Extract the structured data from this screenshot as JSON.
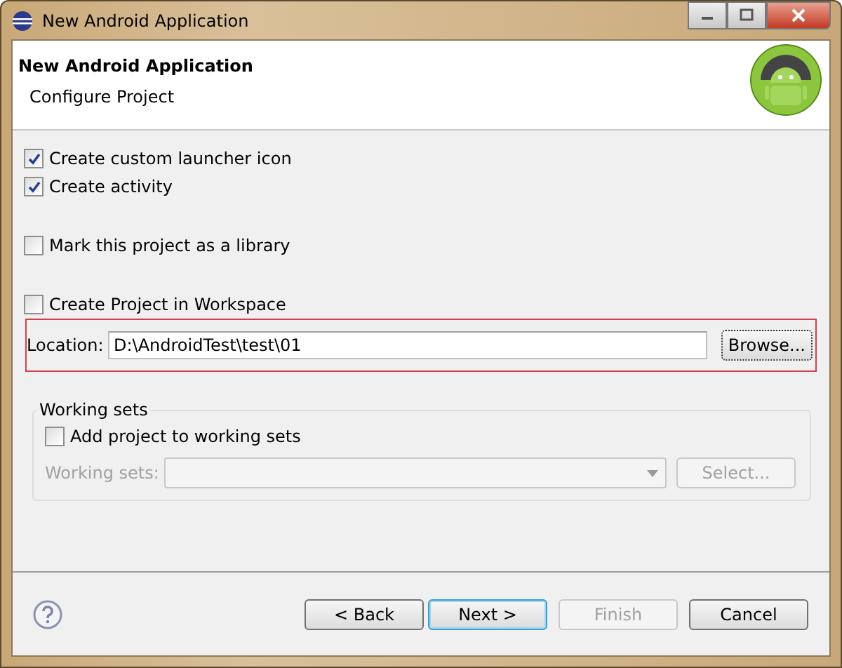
{
  "window": {
    "title": "New Android Application"
  },
  "header": {
    "title": "New Android Application",
    "subtitle": "Configure Project"
  },
  "options": [
    {
      "label": "Create custom launcher icon",
      "checked": true
    },
    {
      "label": "Create activity",
      "checked": true
    },
    {
      "label": "Mark this project as a library",
      "checked": false
    },
    {
      "label": "Create Project in Workspace",
      "checked": false
    }
  ],
  "location": {
    "label": "Location:",
    "value": "D:\\AndroidTest\\test\\01",
    "button": "Browse...",
    "highlighted": true
  },
  "working_sets": {
    "title": "Working sets",
    "add": {
      "label": "Add project to working sets",
      "checked": false
    },
    "label": "Working sets:",
    "disabled": true,
    "button": "Select..."
  },
  "buttons": [
    {
      "label": "< Back",
      "disabled": false,
      "default": false
    },
    {
      "label": "Next >",
      "disabled": false,
      "default": true
    },
    {
      "label": "Finish",
      "disabled": true,
      "default": false
    },
    {
      "label": "Cancel",
      "disabled": false,
      "default": false
    }
  ]
}
